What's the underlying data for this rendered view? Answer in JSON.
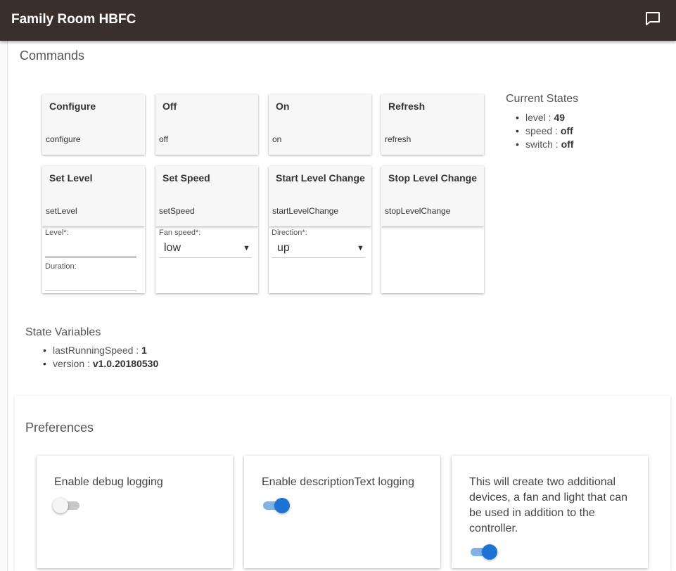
{
  "app": {
    "title": "Family Room HBFC",
    "chat_icon": "chat-icon"
  },
  "commands": {
    "title": "Commands",
    "items": [
      {
        "name": "Configure",
        "method": "configure"
      },
      {
        "name": "Off",
        "method": "off"
      },
      {
        "name": "On",
        "method": "on"
      },
      {
        "name": "Refresh",
        "method": "refresh"
      },
      {
        "name": "Set Level",
        "method": "setLevel"
      },
      {
        "name": "Set Speed",
        "method": "setSpeed"
      },
      {
        "name": "Start Level Change",
        "method": "startLevelChange"
      },
      {
        "name": "Stop Level Change",
        "method": "stopLevelChange"
      }
    ],
    "set_level": {
      "level_label": "Level*:",
      "level_value": "",
      "duration_label": "Duration:",
      "duration_value": ""
    },
    "set_speed": {
      "label": "Fan speed*:",
      "value": "low"
    },
    "start_level_change": {
      "label": "Direction*:",
      "value": "up"
    }
  },
  "current_states": {
    "title": "Current States",
    "items": [
      {
        "key": "level",
        "value": "49"
      },
      {
        "key": "speed",
        "value": "off"
      },
      {
        "key": "switch",
        "value": "off"
      }
    ]
  },
  "state_variables": {
    "title": "State Variables",
    "items": [
      {
        "key": "lastRunningSpeed",
        "value": "1"
      },
      {
        "key": "version",
        "value": "v1.0.20180530"
      }
    ]
  },
  "preferences": {
    "title": "Preferences",
    "items": [
      {
        "label": "Enable debug logging",
        "enabled": false
      },
      {
        "label": "Enable descriptionText logging",
        "enabled": true
      },
      {
        "label": "This will create two additional devices, a fan and light that can be used in addition to the controller.",
        "enabled": true
      }
    ]
  },
  "colors": {
    "header_bg": "#3b2f2c",
    "toggle_on": "#1e74d4",
    "input_active": "#8b2b3a"
  }
}
